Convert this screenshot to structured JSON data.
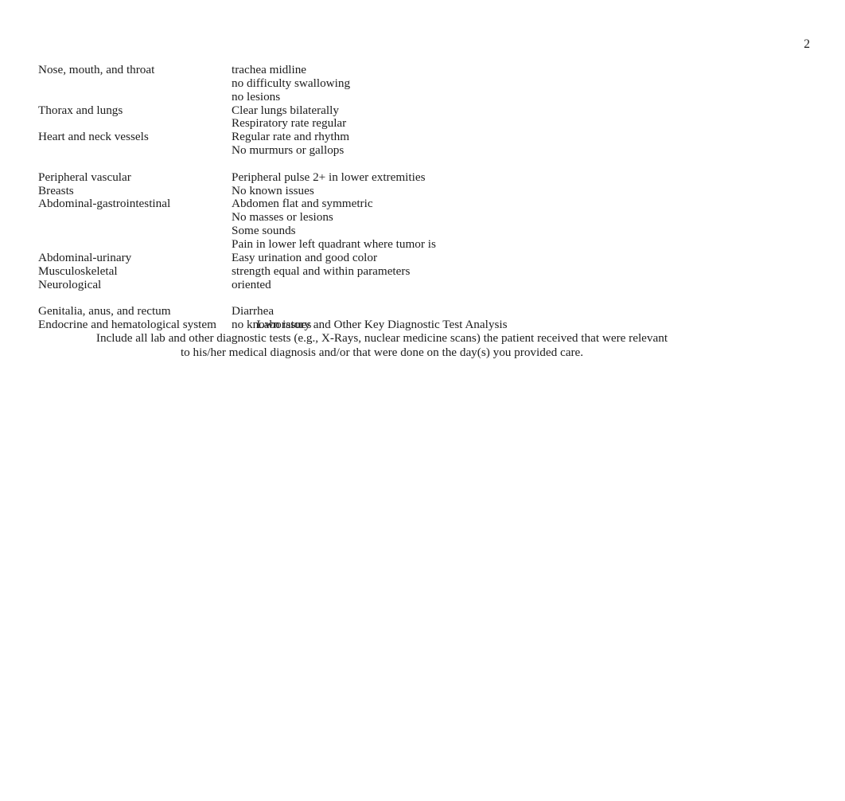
{
  "document": {
    "page_number": "2"
  },
  "assessment": {
    "rows": [
      {
        "label": "Nose, mouth, and throat",
        "findings": [
          "trachea midline",
          "no difficulty swallowing",
          "no lesions"
        ],
        "gap_before": false
      },
      {
        "label": "Thorax and lungs",
        "findings": [
          "Clear lungs bilaterally",
          "Respiratory rate regular"
        ],
        "gap_before": false
      },
      {
        "label": "Heart and neck vessels",
        "findings": [
          "Regular rate and rhythm",
          "No murmurs or gallops"
        ],
        "gap_before": false
      },
      {
        "label": "Peripheral vascular",
        "findings": [
          "Peripheral pulse 2+ in lower extremities"
        ],
        "gap_before": true
      },
      {
        "label": "Breasts",
        "findings": [
          "No known issues"
        ],
        "gap_before": false
      },
      {
        "label": "Abdominal-gastrointestinal",
        "findings": [
          "Abdomen flat and symmetric",
          "No masses or lesions",
          "Some sounds",
          "Pain in lower left quadrant where tumor is"
        ],
        "gap_before": false
      },
      {
        "label": "Abdominal-urinary",
        "findings": [
          "Easy urination and good color"
        ],
        "gap_before": false
      },
      {
        "label": "Musculoskeletal",
        "findings": [
          "strength equal and within parameters"
        ],
        "gap_before": false
      },
      {
        "label": "Neurological",
        "findings": [
          "oriented"
        ],
        "gap_before": false
      },
      {
        "label": "Genitalia, anus, and rectum",
        "findings": [
          "Diarrhea"
        ],
        "gap_before": true
      },
      {
        "label": "Endocrine and hematological system",
        "findings": [
          "no known issues"
        ],
        "gap_before": false
      }
    ]
  },
  "lab_section": {
    "heading": "Laboratory and Other Key Diagnostic Test Analysis",
    "instruction_lines": [
      "Include all lab and other diagnostic tests (e.g., X-Rays, nuclear medicine scans) the patient received that were relevant",
      "to his/her medical diagnosis and/or that were done on the day(s) you provided care."
    ]
  }
}
